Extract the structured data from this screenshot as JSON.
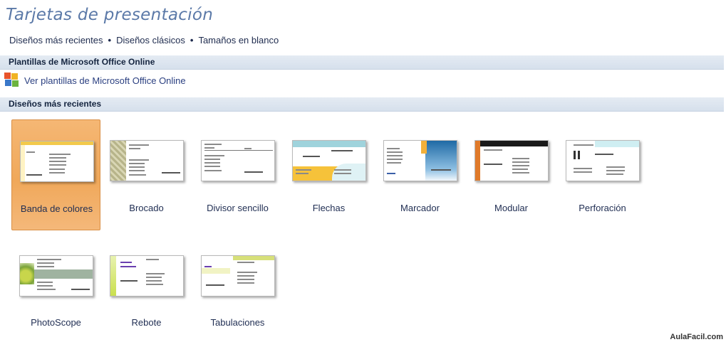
{
  "page_title": "Tarjetas de presentación",
  "nav": {
    "links": [
      "Diseños más recientes",
      "Diseños clásicos",
      "Tamaños en blanco"
    ],
    "separator": "•"
  },
  "sections": {
    "online": {
      "header": "Plantillas de Microsoft Office Online",
      "link": "Ver plantillas de Microsoft Office Online"
    },
    "recent": {
      "header": "Diseños más recientes",
      "templates": [
        {
          "label": "Banda de colores",
          "selected": true
        },
        {
          "label": "Brocado",
          "selected": false
        },
        {
          "label": "Divisor sencillo",
          "selected": false
        },
        {
          "label": "Flechas",
          "selected": false
        },
        {
          "label": "Marcador",
          "selected": false
        },
        {
          "label": "Modular",
          "selected": false
        },
        {
          "label": "Perforación",
          "selected": false
        },
        {
          "label": "PhotoScope",
          "selected": false
        },
        {
          "label": "Rebote",
          "selected": false
        },
        {
          "label": "Tabulaciones",
          "selected": false
        }
      ]
    }
  },
  "watermark": "AulaFacil.com",
  "colors": {
    "title": "#5b79a8",
    "selected_tile": "#f0a85a",
    "section_bar": "#dbe4ef"
  }
}
